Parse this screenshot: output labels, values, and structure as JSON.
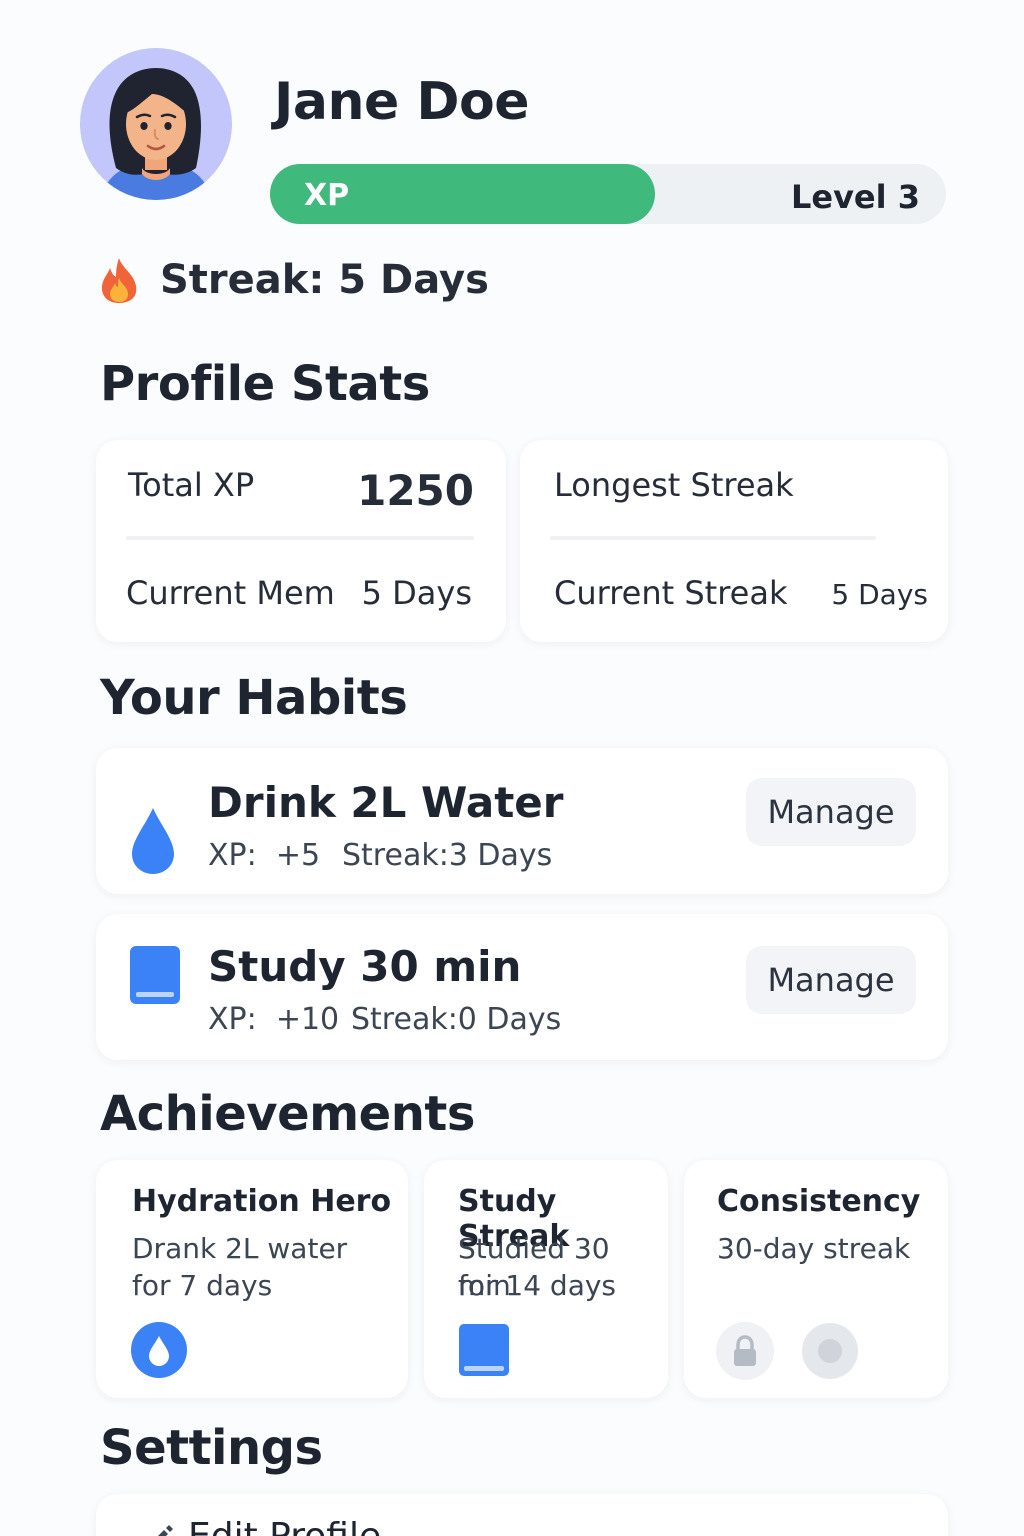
{
  "profile": {
    "name": "Jane Doe",
    "xp_label": "XP",
    "xp_progress": 0.57,
    "level_label": "Level 3",
    "streak_text": "Streak: 5 Days"
  },
  "sections": {
    "stats_title": "Profile Stats",
    "habits_title": "Your Habits",
    "achievements_title": "Achievements",
    "settings_title": "Settings"
  },
  "stats": {
    "total_xp_label": "Total XP",
    "total_xp_value": "1250",
    "current_left_label": "Current Mem",
    "current_left_value": "5 Days",
    "longest_streak_label": "Longest Streak",
    "current_streak_label": "Current Streak",
    "current_streak_value": "5 Days"
  },
  "habits": [
    {
      "icon": "water-drop-icon",
      "name": "Drink 2L Water",
      "xp": "XP:  +5",
      "streak": "Streak:3 Days",
      "button": "Manage"
    },
    {
      "icon": "book-icon",
      "name": "Study 30 min",
      "xp": "XP:  +10",
      "streak": "Streak:0 Days",
      "button": "Manage"
    }
  ],
  "achievements": [
    {
      "title": "Hydration Hero",
      "desc_line1": "Drank 2L water",
      "desc_line2": "for 7 days",
      "icon": "water-drop-badge-icon",
      "unlocked": true
    },
    {
      "title": "Study Streak",
      "desc_line1": "Studied 30 min",
      "desc_line2": "for 14 days",
      "icon": "book-icon",
      "unlocked": true
    },
    {
      "title": "Consistency",
      "desc_line1": "30-day streak",
      "desc_line2": "",
      "icon": "lock-icon",
      "unlocked": false
    }
  ],
  "settings": {
    "items": [
      {
        "icon": "pencil-icon",
        "label": "Edit Profile"
      }
    ]
  },
  "colors": {
    "xp_green": "#3fb97c",
    "accent_blue": "#3b82f6",
    "avatar_bg": "#c3c6fb"
  }
}
